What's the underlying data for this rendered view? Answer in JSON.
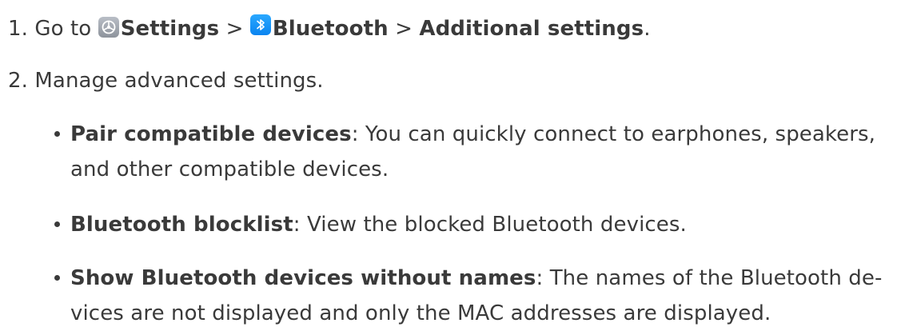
{
  "steps": [
    {
      "number": "1.",
      "prefix": "Go to ",
      "settings": "Settings",
      "sep1": " > ",
      "bluetooth": "Bluetooth",
      "sep2": " > ",
      "additional": "Additional settings",
      "end": "."
    },
    {
      "number": "2.",
      "text": "Manage advanced settings."
    }
  ],
  "icons": {
    "settings_icon": "settings-icon",
    "bluetooth_icon": "bluetooth-icon"
  },
  "bullets": [
    {
      "title": "Pair compatible devices",
      "colon": ":",
      "line1": " You can quickly connect to earphones, speakers,",
      "line2": "and other compatible devices."
    },
    {
      "title": "Bluetooth blocklist",
      "colon": ":",
      "line1": " View the blocked Bluetooth devices."
    },
    {
      "title": "Show Bluetooth devices without names",
      "colon": ":",
      "line1": " The names of the Bluetooth de-",
      "line2": "vices are not displayed and only the MAC addresses are displayed."
    }
  ],
  "colors": {
    "text": "#3a3a3a",
    "bluetooth_blue": "#0a84f0",
    "settings_gray": "#8d939c"
  }
}
